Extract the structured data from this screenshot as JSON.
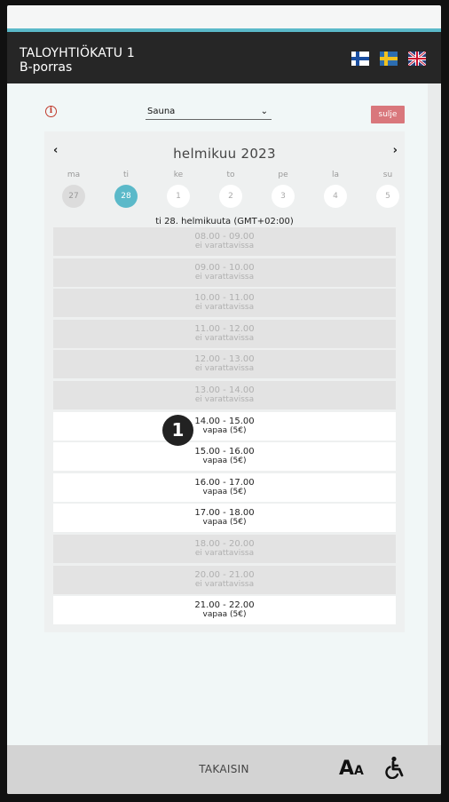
{
  "header": {
    "title_line1": "TALOYHTIÖKATU 1",
    "title_line2": "B-porras",
    "languages": [
      "fi-flag-icon",
      "se-flag-icon",
      "uk-flag-icon"
    ]
  },
  "toolbar": {
    "select_value": "Sauna",
    "close_label": "sulje"
  },
  "calendar": {
    "month_label": "helmikuu 2023",
    "weekdays": [
      "ma",
      "ti",
      "ke",
      "to",
      "pe",
      "la",
      "su"
    ],
    "days": [
      "27",
      "28",
      "1",
      "2",
      "3",
      "4",
      "5"
    ],
    "selected_date_label": "ti 28. helmikuuta (GMT+02:00)"
  },
  "slots": [
    {
      "time": "08.00 - 09.00",
      "status": "ei varattavissa",
      "available": false
    },
    {
      "time": "09.00 - 10.00",
      "status": "ei varattavissa",
      "available": false
    },
    {
      "time": "10.00 - 11.00",
      "status": "ei varattavissa",
      "available": false
    },
    {
      "time": "11.00 - 12.00",
      "status": "ei varattavissa",
      "available": false
    },
    {
      "time": "12.00 - 13.00",
      "status": "ei varattavissa",
      "available": false
    },
    {
      "time": "13.00 - 14.00",
      "status": "ei varattavissa",
      "available": false
    },
    {
      "time": "14.00 - 15.00",
      "status": "vapaa (5€)",
      "available": true
    },
    {
      "time": "15.00 - 16.00",
      "status": "vapaa (5€)",
      "available": true
    },
    {
      "time": "16.00 - 17.00",
      "status": "vapaa (5€)",
      "available": true
    },
    {
      "time": "17.00 - 18.00",
      "status": "vapaa (5€)",
      "available": true
    },
    {
      "time": "18.00 - 20.00",
      "status": "ei varattavissa",
      "available": false
    },
    {
      "time": "20.00 - 21.00",
      "status": "ei varattavissa",
      "available": false
    },
    {
      "time": "21.00 - 22.00",
      "status": "vapaa (5€)",
      "available": true
    }
  ],
  "annotation": {
    "badge": "1"
  },
  "footer": {
    "back_label": "TAKAISIN",
    "font_size_big": "A",
    "font_size_small": "A"
  },
  "colors": {
    "accent": "#5bb9c9",
    "close": "#d9777c",
    "header": "#262626"
  }
}
